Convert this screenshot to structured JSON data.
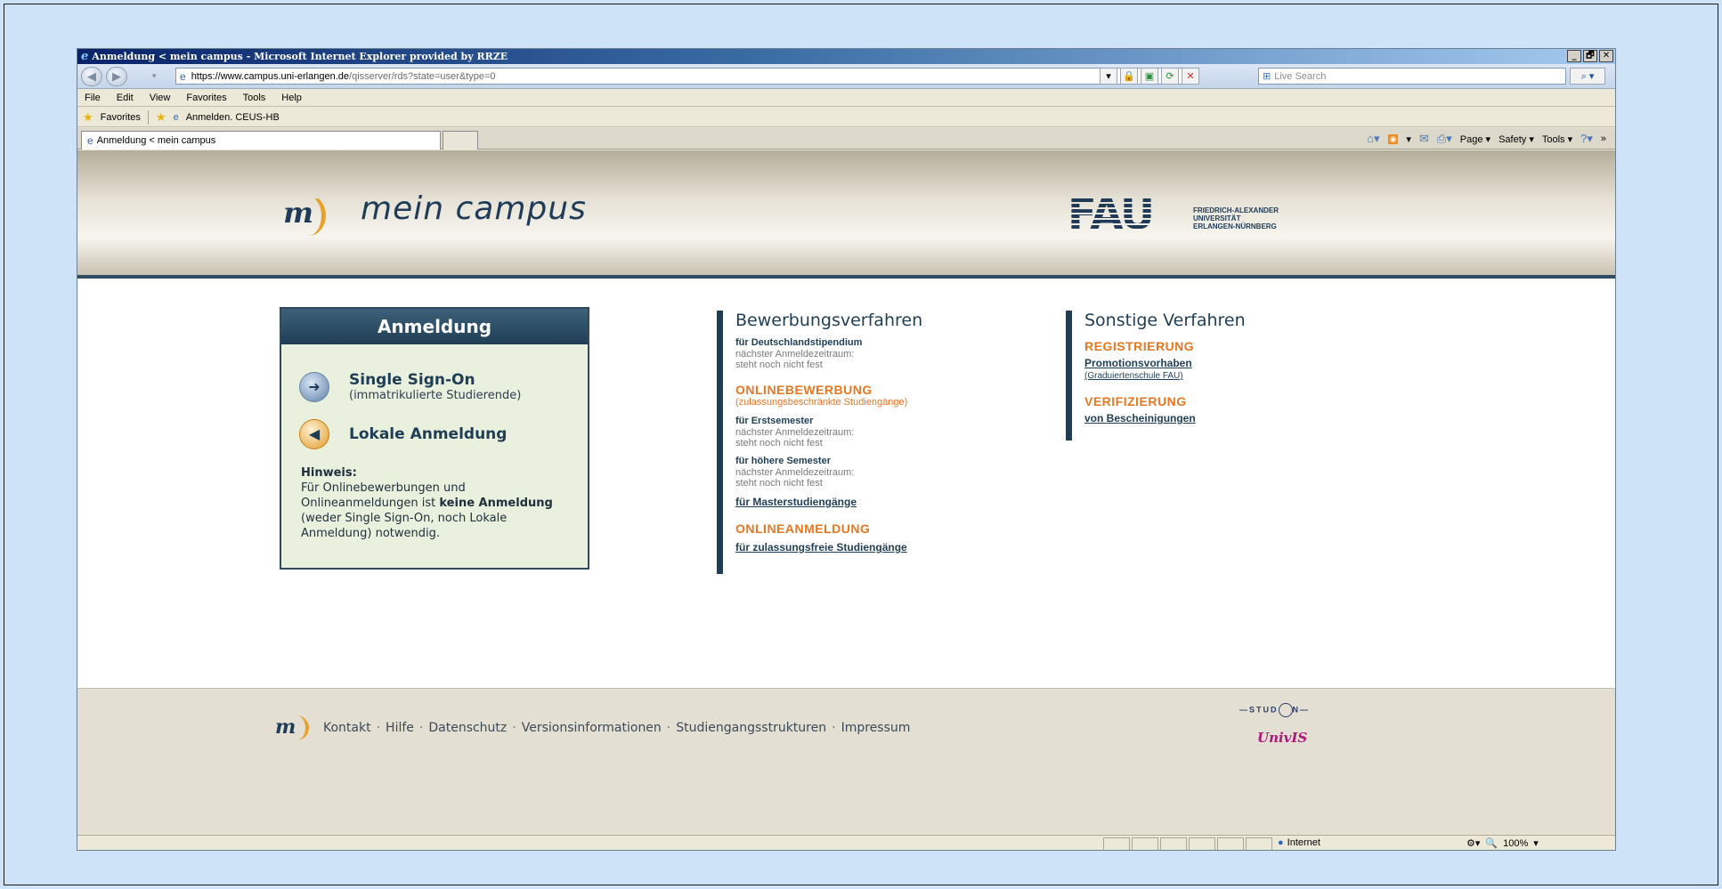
{
  "window": {
    "title": "Anmeldung < mein campus - Microsoft Internet Explorer provided by RRZE",
    "min": "_",
    "max": "🗗",
    "close": "✕"
  },
  "address": {
    "url_host": "https://www.campus.uni-erlangen.de",
    "url_path": "/qisserver/rds?state=user&type=0",
    "search_placeholder": "Live Search"
  },
  "menu": [
    "File",
    "Edit",
    "View",
    "Favorites",
    "Tools",
    "Help"
  ],
  "favorites": {
    "label": "Favorites",
    "item": "Anmelden. CEUS-HB"
  },
  "tab": {
    "label": "Anmeldung < mein campus"
  },
  "command_bar": {
    "page": "Page ▾",
    "safety": "Safety ▾",
    "tools": "Tools ▾"
  },
  "site": {
    "brand": "mein campus",
    "fau": "FAU",
    "fau_line1": "FRIEDRICH-ALEXANDER",
    "fau_line2": "UNIVERSITÄT",
    "fau_line3": "ERLANGEN-NÜRNBERG"
  },
  "login": {
    "title": "Anmeldung",
    "sso_label": "Single Sign-On",
    "sso_sub": "(immatrikulierte Studierende)",
    "local_label": "Lokale Anmeldung",
    "hint_title": "Hinweis:",
    "hint_text1": "Für Onlinebewerbungen und Onlineanmeldungen ist ",
    "hint_bold": "keine Anmeldung",
    "hint_text2": " (weder Single Sign-On, noch Lokale Anmeldung) notwendig."
  },
  "bewerbung": {
    "title": "Bewerbungsverfahren",
    "deutschland_head": "für Deutschlandstipendium",
    "deutschland_l1": "nächster Anmeldezeitraum:",
    "deutschland_l2": "steht noch nicht fest",
    "online_head": "ONLINEBEWERBUNG",
    "online_sub": "(zulassungsbeschränkte Studiengänge)",
    "erst_head": "für Erstsemester",
    "erst_l1": "nächster Anmeldezeitraum:",
    "erst_l2": "steht noch nicht fest",
    "hoeher_head": "für höhere Semester",
    "hoeher_l1": "nächster Anmeldezeitraum:",
    "hoeher_l2": "steht noch nicht fest",
    "master_link": "für Masterstudiengänge",
    "anmeldung_head": "ONLINEANMELDUNG",
    "frei_link": "für zulassungsfreie Studiengänge"
  },
  "sonstige": {
    "title": "Sonstige Verfahren",
    "reg_head": "REGISTRIERUNG",
    "promo_link": "Promotionsvorhaben",
    "grad_link": "(Graduiertenschule FAU)",
    "verif_head": "VERIFIZIERUNG",
    "besch_link": "von Bescheinigungen"
  },
  "footer": {
    "links": [
      "Kontakt",
      "Hilfe",
      "Datenschutz",
      "Versionsinformationen",
      "Studiengangsstrukturen",
      "Impressum"
    ],
    "separator": "·",
    "studon": "STUD",
    "studon_end": "N",
    "univis": "UnivIS"
  },
  "status": {
    "zone": "Internet",
    "zoom": "100%"
  }
}
